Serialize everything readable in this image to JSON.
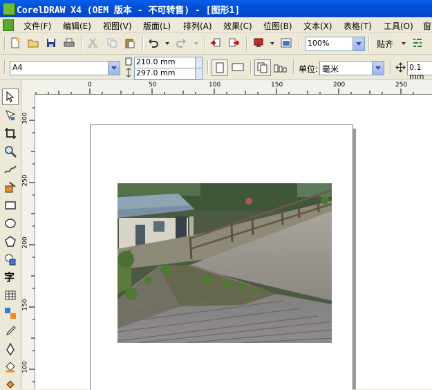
{
  "window": {
    "title": "CorelDRAW X4 (OEM 版本 - 不可转售) - [图形1]"
  },
  "menu": {
    "items": [
      "文件(F)",
      "编辑(E)",
      "视图(V)",
      "版面(L)",
      "排列(A)",
      "效果(C)",
      "位图(B)",
      "文本(X)",
      "表格(T)",
      "工具(O)",
      "窗"
    ]
  },
  "toolbar": {
    "zoom_value": "100%",
    "snap_label": "贴齐"
  },
  "property_bar": {
    "page_size": "A4",
    "width": "210.0 mm",
    "height": "297.0 mm",
    "units_label": "单位:",
    "units_value": "毫米",
    "nudge_value": "0.1 mm"
  },
  "rulers": {
    "horizontal_labels": [
      "0",
      "50",
      "100",
      "150",
      "200",
      "250"
    ],
    "vertical_labels": [
      "300",
      "250",
      "200",
      "150",
      "100"
    ]
  },
  "toolbox": {
    "text_tool_glyph": "字"
  },
  "colors": {
    "titlebar": "#0a5ee8",
    "background": "#ece9d8",
    "canvas": "#ffffff"
  }
}
